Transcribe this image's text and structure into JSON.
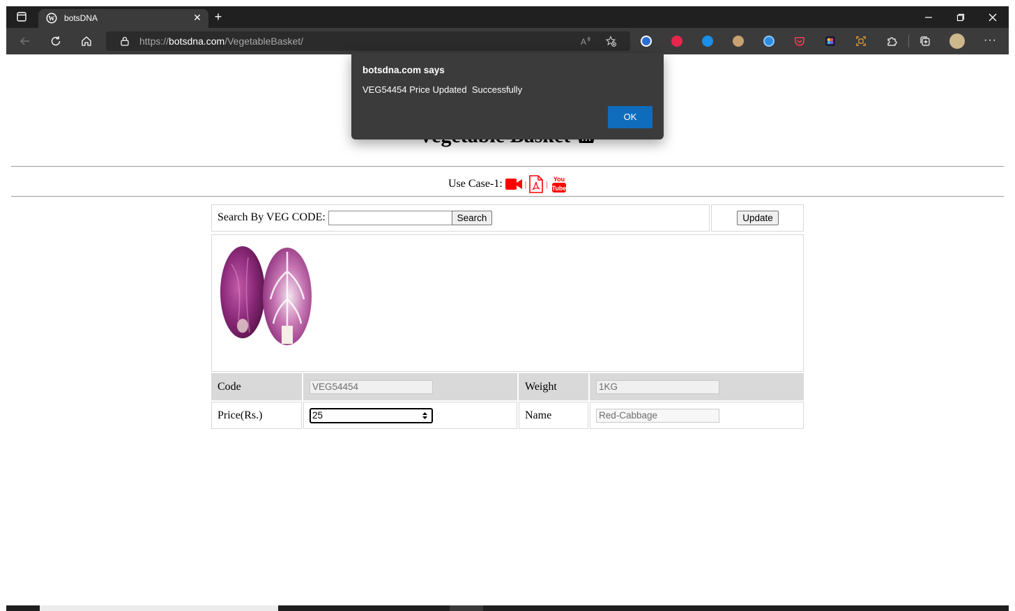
{
  "browser": {
    "tab_title": "botsDNA",
    "url_scheme": "https://",
    "url_host": "botsdna.com",
    "url_path": "/VegetableBasket/"
  },
  "page": {
    "title": "Vegetable Basket",
    "use_case_label": "Use Case-1:",
    "search_label": "Search By VEG CODE:",
    "search_value": "",
    "search_button": "Search",
    "update_button": "Update",
    "fields": {
      "code_label": "Code",
      "code_value": "VEG54454",
      "weight_label": "Weight",
      "weight_value": "1KG",
      "price_label": "Price(Rs.)",
      "price_value": "25",
      "name_label": "Name",
      "name_value": "Red-Cabbage"
    }
  },
  "dialog": {
    "title": "botsdna.com says",
    "message": "VEG54454 Price Updated  Successfully",
    "ok_label": "OK"
  },
  "colors": {
    "accent_blue": "#0f6cbd",
    "icon_red": "#ff0000"
  }
}
